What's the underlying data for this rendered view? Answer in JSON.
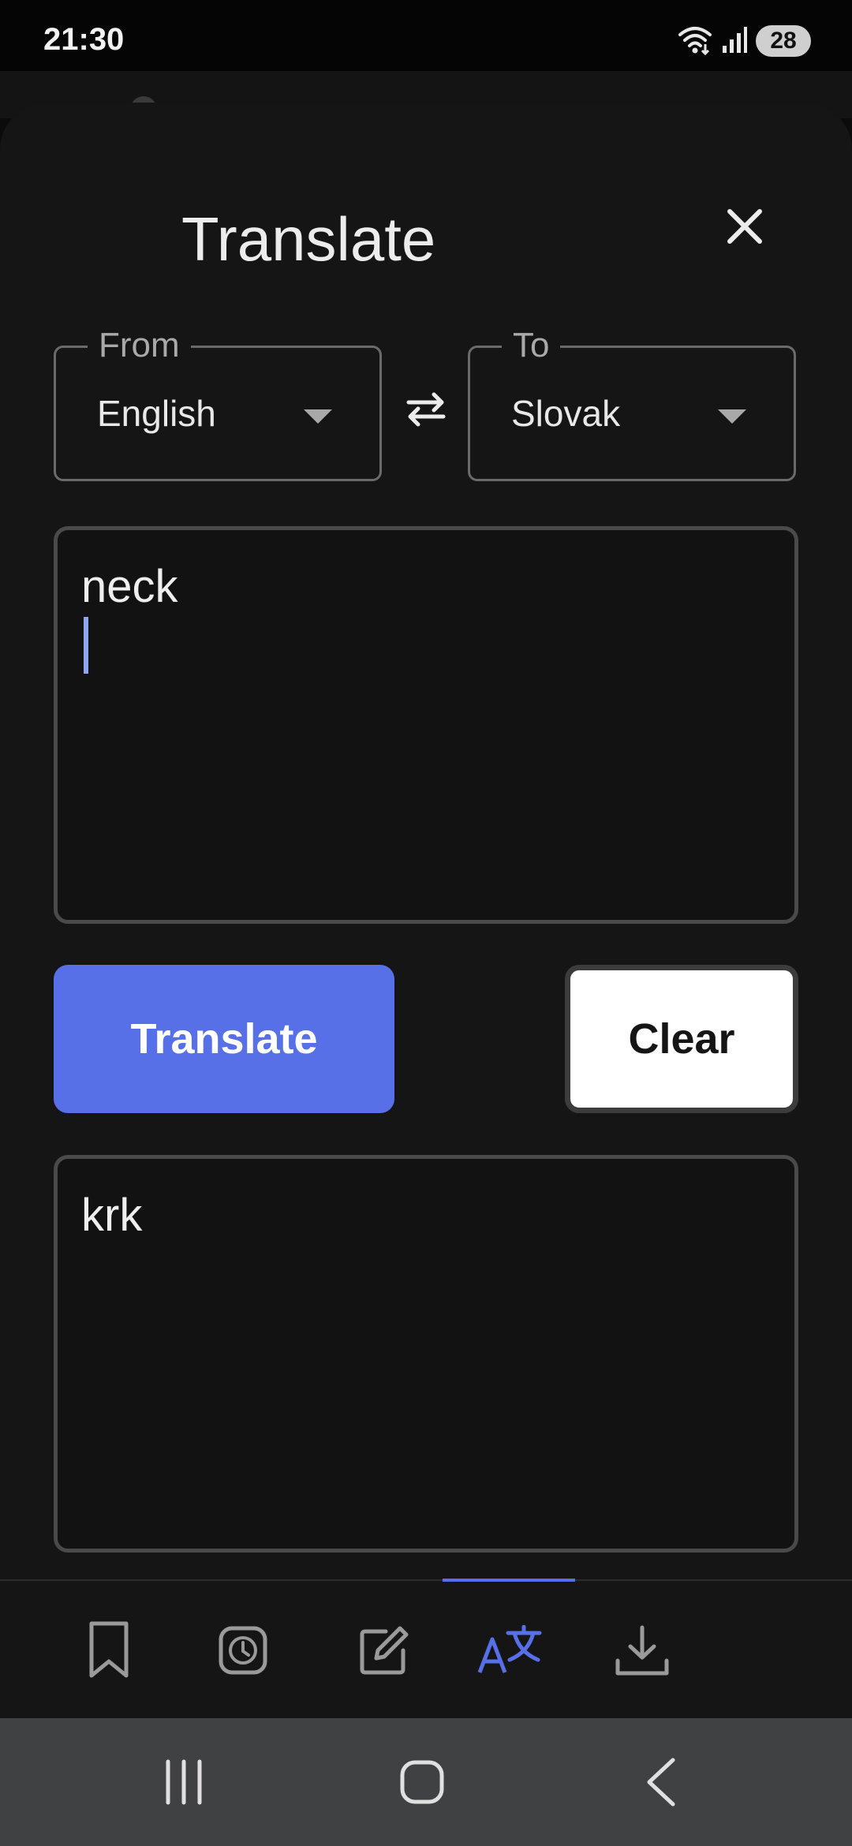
{
  "status_bar": {
    "time": "21:30",
    "battery": "28",
    "icons": [
      "wifi-icon",
      "signal-icon"
    ]
  },
  "dialog": {
    "title": "Translate",
    "close_icon": "close-icon"
  },
  "from_field": {
    "legend": "From",
    "value": "English"
  },
  "to_field": {
    "legend": "To",
    "value": "Slovak"
  },
  "swap_icon": "swap-arrows-icon",
  "input_text": "neck",
  "output_text": "krk",
  "buttons": {
    "translate": "Translate",
    "clear": "Clear"
  },
  "bottom_nav": {
    "items": [
      {
        "icon": "bookmark-icon",
        "active": false
      },
      {
        "icon": "history-icon",
        "active": false
      },
      {
        "icon": "edit-icon",
        "active": false
      },
      {
        "icon": "translate-icon",
        "active": true
      },
      {
        "icon": "download-icon",
        "active": false
      }
    ]
  },
  "system_nav": {
    "items": [
      "recents-icon",
      "home-icon",
      "back-icon"
    ]
  },
  "colors": {
    "accent": "#5770e8",
    "sheet_bg": "#151516",
    "text": "#ececec",
    "system_nav_bg": "#404143"
  }
}
